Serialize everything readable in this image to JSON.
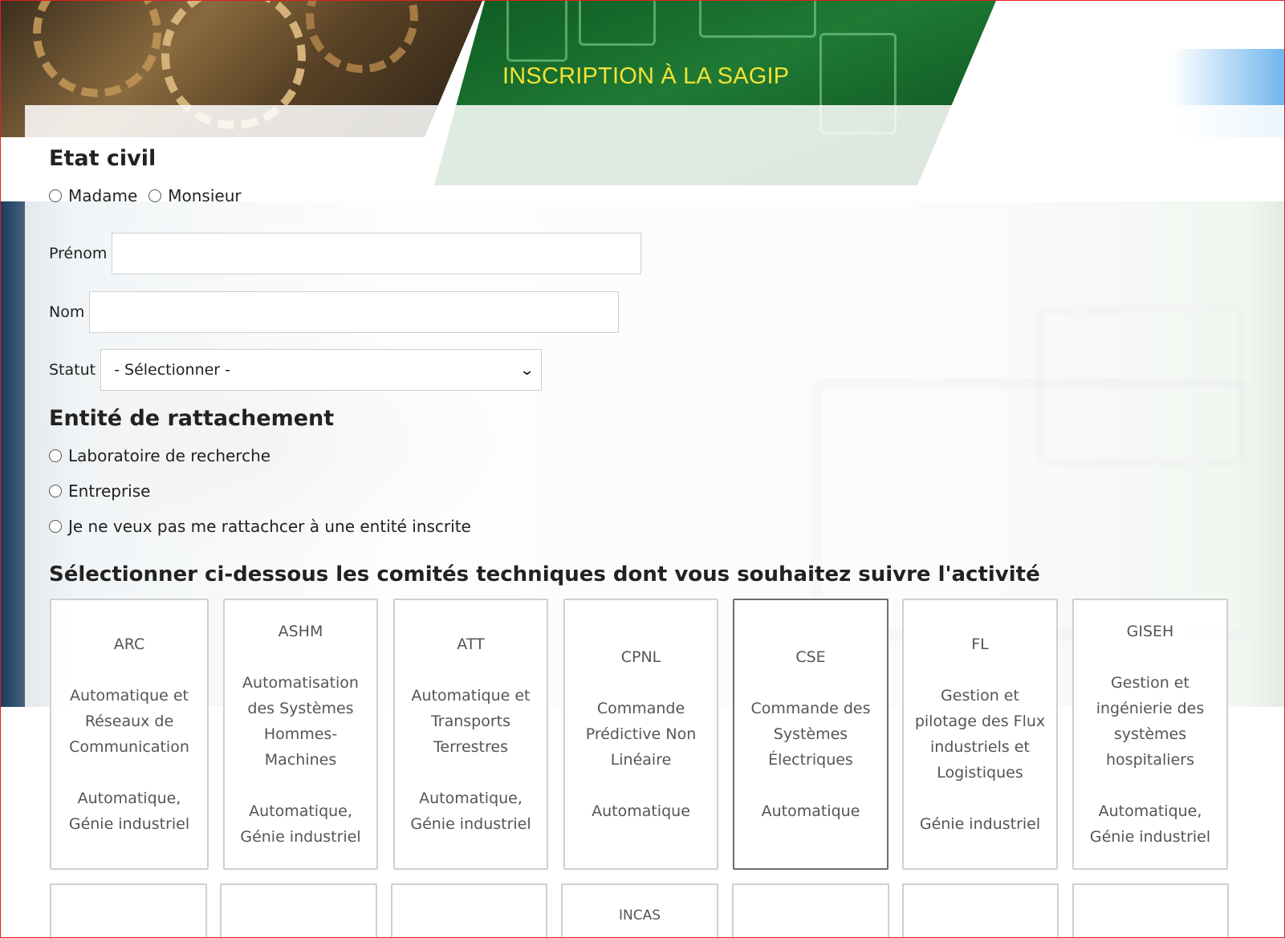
{
  "banner": {
    "title": "INSCRIPTION À LA SAGIP"
  },
  "etat_civil": {
    "title": "Etat civil",
    "options": [
      "Madame",
      "Monsieur"
    ]
  },
  "fields": {
    "prenom_label": "Prénom",
    "prenom_value": "",
    "nom_label": "Nom",
    "nom_value": "",
    "statut_label": "Statut",
    "statut_selected": "- Sélectionner -"
  },
  "entite": {
    "title": "Entité de rattachement",
    "options": [
      "Laboratoire de recherche",
      "Entreprise",
      "Je ne veux pas me rattachcer à une entité inscrite"
    ]
  },
  "comites": {
    "title": "Sélectionner ci-dessous les comités techniques dont vous souhaitez suivre l'activité",
    "cards": [
      {
        "code": "ARC",
        "name": "Automatique et Réseaux de Communication",
        "domain": "Automatique, Génie industriel"
      },
      {
        "code": "ASHM",
        "name": "Automatisation des Systèmes Hommes-Machines",
        "domain": "Automatique, Génie industriel"
      },
      {
        "code": "ATT",
        "name": "Automatique et Transports Terrestres",
        "domain": "Automatique, Génie industriel"
      },
      {
        "code": "CPNL",
        "name": "Commande Prédictive Non Linéaire",
        "domain": "Automatique"
      },
      {
        "code": "CSE",
        "name": "Commande des Systèmes Électriques",
        "domain": "Automatique"
      },
      {
        "code": "FL",
        "name": "Gestion et pilotage des Flux industriels et Logistiques",
        "domain": "Génie industriel"
      },
      {
        "code": "GISEH",
        "name": "Gestion et ingénierie des systèmes hospitaliers",
        "domain": "Automatique, Génie industriel"
      }
    ],
    "second_row": [
      "",
      "",
      "",
      "INCAS",
      "",
      "",
      ""
    ]
  }
}
